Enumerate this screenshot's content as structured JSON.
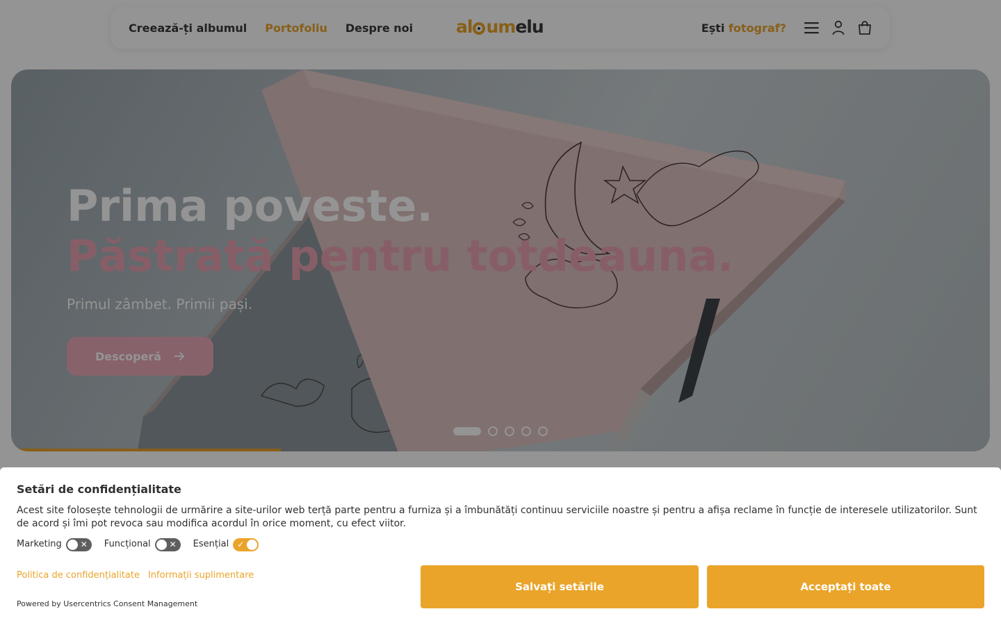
{
  "header": {
    "nav": [
      {
        "label": "Creează-ți albumul",
        "active": false
      },
      {
        "label": "Portofoliu",
        "active": true
      },
      {
        "label": "Despre noi",
        "active": false
      }
    ],
    "logo": {
      "part1": "al",
      "part2": "um",
      "part3": "elu"
    },
    "photographer_prefix": "Ești",
    "photographer_highlight": "fotograf?",
    "icons": [
      "menu-icon",
      "user-icon",
      "shopping-bag-icon"
    ]
  },
  "hero": {
    "title_line1": "Prima poveste.",
    "title_line2": "Păstrată pentru totdeauna.",
    "subtitle": "Primul zâmbet. Primii pași.",
    "cta_label": "Descoperă",
    "slides_count": 5,
    "active_slide": 1,
    "slide_progress": 0.27,
    "colors": {
      "title_accent": "#e8a3b2",
      "cta_bg": "#eba9b8",
      "progress": "#eaa42a"
    }
  },
  "consent": {
    "title": "Setări de confidențialitate",
    "text": "Acest site folosește tehnologii de urmărire a site-urilor web terță parte pentru a furniza și a îmbunătăți continuu serviciile noastre și pentru a afișa reclame în funcție de interesele utilizatorilor. Sunt de acord și îmi pot revoca sau modifica acordul în orice moment, cu efect viitor.",
    "toggles": [
      {
        "label": "Marketing",
        "on": false
      },
      {
        "label": "Funcțional",
        "on": false
      },
      {
        "label": "Esențial",
        "on": true
      }
    ],
    "links": {
      "privacy": "Politica de confidențialitate",
      "more_info": "Informații suplimentare"
    },
    "powered_by": "Powered by Usercentrics Consent Management",
    "save_label": "Salvați setările",
    "accept_label": "Acceptați toate",
    "accent_color": "#eaa42a"
  }
}
